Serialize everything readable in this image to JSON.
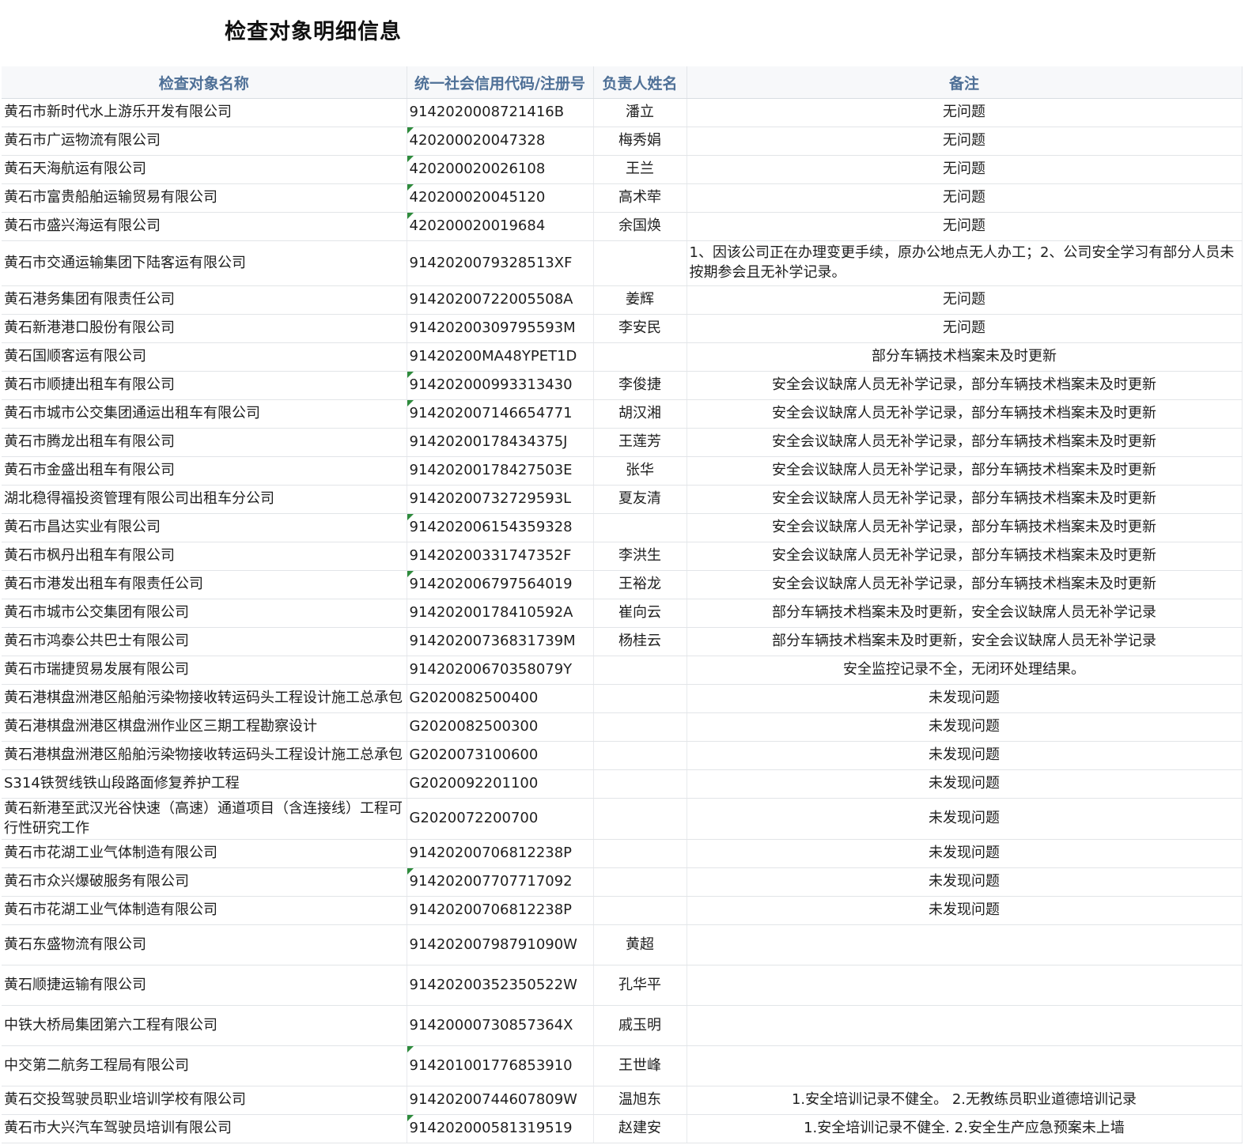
{
  "title": "检查对象明细信息",
  "headers": [
    "检查对象名称",
    "统一社会信用代码/注册号",
    "负责人姓名",
    "备注"
  ],
  "rows": [
    {
      "name": "黄石市新时代水上游乐开发有限公司",
      "code": "9142020008721416B",
      "person": "潘立",
      "note": "无问题",
      "flag": false,
      "h": 36
    },
    {
      "name": "黄石市广运物流有限公司",
      "code": "420200020047328",
      "person": "梅秀娟",
      "note": "无问题",
      "flag": true,
      "h": 36
    },
    {
      "name": "黄石天海航运有限公司",
      "code": "420200020026108",
      "person": "王兰",
      "note": "无问题",
      "flag": true,
      "h": 36
    },
    {
      "name": "黄石市富贵船舶运输贸易有限公司",
      "code": "420200020045120",
      "person": "高术荦",
      "note": "无问题",
      "flag": true,
      "h": 36
    },
    {
      "name": "黄石市盛兴海运有限公司",
      "code": "420200020019684",
      "person": "余国焕",
      "note": "无问题",
      "flag": true,
      "h": 36
    },
    {
      "name": "黄石市交通运输集团下陆客运有限公司",
      "code": "9142020079328513XF",
      "person": "",
      "note": "1、因该公司正在办理变更手续，原办公地点无人办工；2、公司安全学习有部分人员未按期参会且无补学记录。",
      "flag": false,
      "h": 57,
      "left": true
    },
    {
      "name": "黄石港务集团有限责任公司",
      "code": "91420200722005508A",
      "person": "姜辉",
      "note": "无问题",
      "flag": false,
      "h": 36
    },
    {
      "name": "黄石新港港口股份有限公司",
      "code": "91420200309795593M",
      "person": "李安民",
      "note": "无问题",
      "flag": false,
      "h": 36
    },
    {
      "name": "黄石国顺客运有限公司",
      "code": "91420200MA48YPET1D",
      "person": "",
      "note": "部分车辆技术档案未及时更新",
      "flag": false,
      "h": 36
    },
    {
      "name": "黄石市顺捷出租车有限公司",
      "code": "914202000993313430",
      "person": "李俊捷",
      "note": "安全会议缺席人员无补学记录，部分车辆技术档案未及时更新",
      "flag": true,
      "h": 36
    },
    {
      "name": "黄石市城市公交集团通运出租车有限公司",
      "code": "914202007146654771",
      "person": "胡汉湘",
      "note": "安全会议缺席人员无补学记录，部分车辆技术档案未及时更新",
      "flag": true,
      "h": 36
    },
    {
      "name": "黄石市腾龙出租车有限公司",
      "code": "91420200178434375J",
      "person": "王莲芳",
      "note": "安全会议缺席人员无补学记录，部分车辆技术档案未及时更新",
      "flag": false,
      "h": 36
    },
    {
      "name": "黄石市金盛出租车有限公司",
      "code": "91420200178427503E",
      "person": "张华",
      "note": "安全会议缺席人员无补学记录，部分车辆技术档案未及时更新",
      "flag": false,
      "h": 36
    },
    {
      "name": "湖北稳得福投资管理有限公司出租车分公司",
      "code": "91420200732729593L",
      "person": "夏友清",
      "note": "安全会议缺席人员无补学记录，部分车辆技术档案未及时更新",
      "flag": false,
      "h": 36
    },
    {
      "name": "黄石市昌达实业有限公司",
      "code": "914202006154359328",
      "person": "",
      "note": "安全会议缺席人员无补学记录，部分车辆技术档案未及时更新",
      "flag": true,
      "h": 36
    },
    {
      "name": "黄石市枫丹出租车有限公司",
      "code": "91420200331747352F",
      "person": "李洪生",
      "note": "安全会议缺席人员无补学记录，部分车辆技术档案未及时更新",
      "flag": false,
      "h": 36
    },
    {
      "name": "黄石市港发出租车有限责任公司",
      "code": "914202006797564019",
      "person": "王裕龙",
      "note": "安全会议缺席人员无补学记录，部分车辆技术档案未及时更新",
      "flag": true,
      "h": 36
    },
    {
      "name": "黄石市城市公交集团有限公司",
      "code": "91420200178410592A",
      "person": "崔向云",
      "note": "部分车辆技术档案未及时更新，安全会议缺席人员无补学记录",
      "flag": false,
      "h": 36
    },
    {
      "name": "黄石市鸿泰公共巴士有限公司",
      "code": "91420200736831739M",
      "person": "杨桂云",
      "note": "部分车辆技术档案未及时更新，安全会议缺席人员无补学记录",
      "flag": false,
      "h": 36
    },
    {
      "name": "黄石市瑞捷贸易发展有限公司",
      "code": "91420200670358079Y",
      "person": "",
      "note": "安全监控记录不全，无闭环处理结果。",
      "flag": false,
      "h": 36
    },
    {
      "name": "黄石港棋盘洲港区船舶污染物接收转运码头工程设计施工总承包",
      "code": "G2020082500400",
      "person": "",
      "note": "未发现问题",
      "flag": false,
      "h": 36
    },
    {
      "name": "黄石港棋盘洲港区棋盘洲作业区三期工程勘察设计",
      "code": "G2020082500300",
      "person": "",
      "note": "未发现问题",
      "flag": false,
      "h": 36
    },
    {
      "name": "黄石港棋盘洲港区船舶污染物接收转运码头工程设计施工总承包",
      "code": "G2020073100600",
      "person": "",
      "note": "未发现问题",
      "flag": false,
      "h": 36
    },
    {
      "name": "S314铁贺线铁山段路面修复养护工程",
      "code": "G2020092201100",
      "person": "",
      "note": "未发现问题",
      "flag": false,
      "h": 36
    },
    {
      "name": "黄石新港至武汉光谷快速（高速）通道项目（含连接线）工程可行性研究工作",
      "code": "G2020072200700",
      "person": "",
      "note": "未发现问题",
      "flag": false,
      "h": 52
    },
    {
      "name": "黄石市花湖工业气体制造有限公司",
      "code": "91420200706812238P",
      "person": "",
      "note": "未发现问题",
      "flag": false,
      "h": 36
    },
    {
      "name": "黄石市众兴爆破服务有限公司",
      "code": "914202007707717092",
      "person": "",
      "note": "未发现问题",
      "flag": true,
      "h": 36
    },
    {
      "name": "黄石市花湖工业气体制造有限公司",
      "code": "91420200706812238P",
      "person": "",
      "note": "未发现问题",
      "flag": false,
      "h": 36
    },
    {
      "name": "黄石东盛物流有限公司",
      "code": "91420200798791090W",
      "person": "黄超",
      "note": "",
      "flag": false,
      "h": 51
    },
    {
      "name": "黄石顺捷运输有限公司",
      "code": "91420200352350522W",
      "person": "孔华平",
      "note": "",
      "flag": false,
      "h": 51
    },
    {
      "name": "中铁大桥局集团第六工程有限公司",
      "code": "91420000730857364X",
      "person": "戚玉明",
      "note": "",
      "flag": false,
      "h": 51
    },
    {
      "name": "中交第二航务工程局有限公司",
      "code": "914201001776853910",
      "person": "王世峰",
      "note": "",
      "flag": true,
      "h": 51
    },
    {
      "name": "黄石交投驾驶员职业培训学校有限公司",
      "code": "91420200744607809W",
      "person": "温旭东",
      "note": "1.安全培训记录不健全。 2.无教练员职业道德培训记录",
      "flag": false,
      "h": 36
    },
    {
      "name": "黄石市大兴汽车驾驶员培训有限公司",
      "code": "914202000581319519",
      "person": "赵建安",
      "note": "1.安全培训记录不健全. 2.安全生产应急预案未上墙",
      "flag": true,
      "h": 36
    }
  ]
}
